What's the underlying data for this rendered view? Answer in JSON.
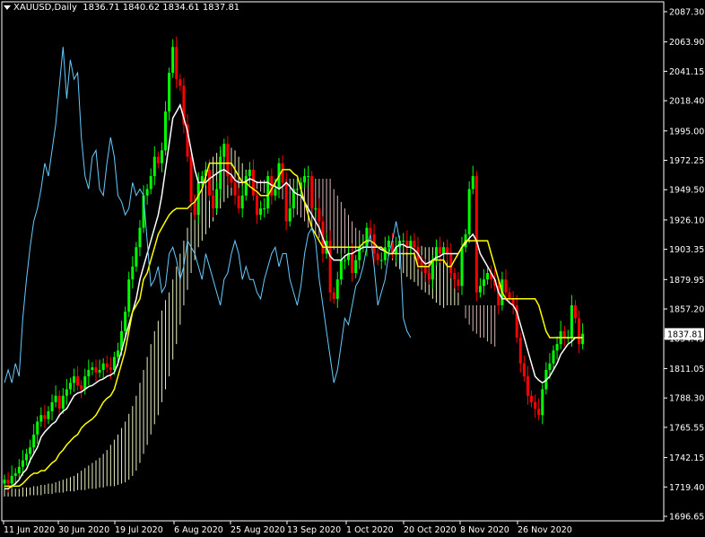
{
  "header": {
    "symbol": "XAUUSD,Daily",
    "ohlc": "1836.71 1840.62 1834.61 1837.81"
  },
  "colors": {
    "background": "#000000",
    "frame": "#ffffff",
    "text": "#ffffff",
    "bull": "#00ff00",
    "bear": "#ff0000",
    "tenkan": "#ffffff",
    "kijun": "#ffff00",
    "chikou": "#66ccff",
    "kumo_bear_hatch": "#d8b8b8",
    "kumo_bull_hatch": "#e8f0c0",
    "price_label_bg": "#ffffff",
    "price_label_text": "#000000"
  },
  "chart_data": {
    "type": "candlestick",
    "title": "XAUUSD,Daily",
    "indicator": "Ichimoku Kinko Hyo",
    "grid": false,
    "ylim": [
      1696.65,
      2087.3
    ],
    "y_ticks": [
      2087.3,
      2063.9,
      2041.15,
      2018.4,
      1995.0,
      1972.25,
      1949.5,
      1926.1,
      1903.35,
      1879.95,
      1857.2,
      1834.45,
      1811.05,
      1788.3,
      1765.55,
      1742.15,
      1719.4,
      1696.65
    ],
    "y_tick_labels": [
      "2087.30",
      "2063.90",
      "2041.15",
      "2018.40",
      "1995.00",
      "1972.25",
      "1949.50",
      "1926.10",
      "1903.35",
      "1879.95",
      "1857.20",
      "1834.45",
      "1811.05",
      "1788.30",
      "1765.55",
      "1742.15",
      "1719.40",
      "1696.65"
    ],
    "x_tick_labels": [
      "11 Jun 2020",
      "30 Jun 2020",
      "19 Jul 2020",
      "6 Aug 2020",
      "25 Aug 2020",
      "13 Sep 2020",
      "1 Oct 2020",
      "20 Oct 2020",
      "8 Nov 2020",
      "26 Nov 2020"
    ],
    "last_price": 1837.81,
    "last_price_label": "1837.81",
    "close": [
      1725,
      1722,
      1728,
      1730,
      1735,
      1740,
      1745,
      1750,
      1760,
      1770,
      1775,
      1772,
      1778,
      1785,
      1790,
      1780,
      1790,
      1795,
      1800,
      1805,
      1798,
      1795,
      1805,
      1810,
      1812,
      1808,
      1810,
      1815,
      1812,
      1810,
      1820,
      1825,
      1840,
      1855,
      1880,
      1890,
      1905,
      1920,
      1945,
      1950,
      1960,
      1975,
      1970,
      1980,
      2010,
      2040,
      2060,
      2035,
      2030,
      2000,
      1975,
      1940,
      1930,
      1955,
      1960,
      1965,
      1945,
      1935,
      1950,
      1975,
      1985,
      1960,
      1955,
      1945,
      1935,
      1945,
      1960,
      1965,
      1945,
      1930,
      1935,
      1935,
      1960,
      1945,
      1950,
      1970,
      1955,
      1925,
      1935,
      1950,
      1950,
      1955,
      1960,
      1960,
      1935,
      1935,
      1925,
      1900,
      1910,
      1870,
      1865,
      1880,
      1895,
      1895,
      1900,
      1885,
      1895,
      1905,
      1905,
      1920,
      1915,
      1900,
      1895,
      1895,
      1905,
      1910,
      1900,
      1905,
      1910,
      1910,
      1905,
      1910,
      1905,
      1895,
      1890,
      1885,
      1880,
      1895,
      1905,
      1900,
      1905,
      1900,
      1885,
      1880,
      1875,
      1905,
      1915,
      1950,
      1960,
      1870,
      1875,
      1880,
      1885,
      1880,
      1875,
      1860,
      1880,
      1870,
      1865,
      1860,
      1835,
      1815,
      1805,
      1790,
      1785,
      1780,
      1775,
      1795,
      1810,
      1815,
      1825,
      1830,
      1840,
      1835,
      1835,
      1860,
      1850,
      1830,
      1838
    ],
    "series": [
      {
        "name": "Tenkan-sen",
        "values": [
          1718,
          1718,
          1720,
          1722,
          1725,
          1730,
          1733,
          1740,
          1745,
          1750,
          1758,
          1762,
          1765,
          1768,
          1770,
          1775,
          1778,
          1780,
          1785,
          1790,
          1792,
          1793,
          1795,
          1797,
          1798,
          1800,
          1802,
          1803,
          1805,
          1806,
          1808,
          1815,
          1825,
          1835,
          1845,
          1855,
          1865,
          1880,
          1890,
          1900,
          1910,
          1920,
          1930,
          1945,
          1965,
          1985,
          2005,
          2010,
          2015,
          2005,
          1995,
          1980,
          1965,
          1955,
          1955,
          1955,
          1958,
          1960,
          1962,
          1964,
          1965,
          1963,
          1961,
          1957,
          1955,
          1955,
          1956,
          1958,
          1957,
          1955,
          1955,
          1955,
          1955,
          1953,
          1952,
          1950,
          1952,
          1955,
          1952,
          1948,
          1946,
          1945,
          1940,
          1935,
          1930,
          1925,
          1920,
          1912,
          1905,
          1898,
          1895,
          1895,
          1895,
          1898,
          1900,
          1900,
          1902,
          1903,
          1905,
          1905,
          1905,
          1905,
          1905,
          1903,
          1902,
          1900,
          1900,
          1905,
          1907,
          1907,
          1905,
          1905,
          1903,
          1900,
          1895,
          1892,
          1893,
          1895,
          1897,
          1898,
          1900,
          1900,
          1900,
          1900,
          1900,
          1905,
          1908,
          1912,
          1915,
          1910,
          1900,
          1895,
          1890,
          1885,
          1880,
          1870,
          1865,
          1865,
          1862,
          1860,
          1855,
          1845,
          1835,
          1825,
          1815,
          1805,
          1802,
          1800,
          1802,
          1805,
          1810,
          1815,
          1822,
          1826,
          1830,
          1832,
          1835,
          1835,
          1835
        ]
      },
      {
        "name": "Kijun-sen",
        "values": [
          1720,
          1720,
          1720,
          1720,
          1720,
          1722,
          1725,
          1728,
          1730,
          1730,
          1732,
          1732,
          1735,
          1738,
          1740,
          1745,
          1748,
          1752,
          1755,
          1758,
          1760,
          1765,
          1768,
          1770,
          1772,
          1775,
          1780,
          1785,
          1788,
          1790,
          1795,
          1805,
          1815,
          1825,
          1840,
          1855,
          1860,
          1865,
          1880,
          1885,
          1895,
          1905,
          1915,
          1920,
          1925,
          1930,
          1933,
          1935,
          1935,
          1935,
          1935,
          1938,
          1940,
          1945,
          1950,
          1960,
          1970,
          1970,
          1970,
          1970,
          1970,
          1970,
          1970,
          1965,
          1960,
          1955,
          1955,
          1952,
          1950,
          1948,
          1945,
          1945,
          1945,
          1950,
          1955,
          1960,
          1965,
          1965,
          1965,
          1962,
          1960,
          1950,
          1940,
          1930,
          1920,
          1915,
          1910,
          1905,
          1905,
          1905,
          1905,
          1905,
          1905,
          1905,
          1905,
          1905,
          1905,
          1905,
          1908,
          1910,
          1910,
          1908,
          1905,
          1905,
          1902,
          1900,
          1900,
          1900,
          1900,
          1900,
          1900,
          1900,
          1900,
          1890,
          1890,
          1890,
          1890,
          1895,
          1895,
          1895,
          1895,
          1890,
          1890,
          1895,
          1900,
          1905,
          1910,
          1910,
          1910,
          1910,
          1910,
          1910,
          1910,
          1900,
          1890,
          1880,
          1870,
          1865,
          1865,
          1865,
          1865,
          1865,
          1865,
          1865,
          1865,
          1865,
          1860,
          1850,
          1840,
          1835,
          1835,
          1835,
          1835,
          1835,
          1835,
          1835,
          1835,
          1835,
          1835
        ]
      },
      {
        "name": "Chikou Span",
        "values": [
          1800,
          1810,
          1800,
          1815,
          1805,
          1850,
          1880,
          1905,
          1925,
          1935,
          1950,
          1970,
          1960,
          1980,
          2000,
          2030,
          2060,
          2020,
          2050,
          2035,
          2040,
          1990,
          1960,
          1950,
          1975,
          1980,
          1950,
          1945,
          1970,
          1990,
          1975,
          1945,
          1940,
          1930,
          1935,
          1955,
          1945,
          1950,
          1945,
          1910,
          1875,
          1880,
          1890,
          1870,
          1875,
          1900,
          1905,
          1895,
          1880,
          1890,
          1910,
          1905,
          1900,
          1890,
          1880,
          1900,
          1890,
          1880,
          1870,
          1860,
          1880,
          1885,
          1900,
          1910,
          1900,
          1880,
          1890,
          1880,
          1880,
          1870,
          1865,
          1880,
          1890,
          1900,
          1905,
          1890,
          1900,
          1900,
          1880,
          1870,
          1860,
          1875,
          1900,
          1915,
          1920,
          1910,
          1880,
          1860,
          1840,
          1820,
          1800,
          1810,
          1830,
          1850,
          1845,
          1860,
          1875,
          1880,
          1890,
          1905,
          1915,
          1890,
          1860,
          1870,
          1880,
          1900,
          1910,
          1925,
          1910,
          1850,
          1840,
          1835
        ]
      },
      {
        "name": "Senkou Span A",
        "values": [
          1718,
          1718,
          1718,
          1718,
          1718,
          1719,
          1719,
          1719,
          1720,
          1720,
          1721,
          1721,
          1722,
          1722,
          1723,
          1724,
          1725,
          1726,
          1727,
          1728,
          1730,
          1732,
          1734,
          1736,
          1738,
          1740,
          1742,
          1745,
          1748,
          1752,
          1756,
          1760,
          1765,
          1770,
          1776,
          1782,
          1790,
          1800,
          1810,
          1820,
          1830,
          1840,
          1848,
          1856,
          1864,
          1870,
          1880,
          1890,
          1900,
          1910,
          1920,
          1932,
          1945,
          1955,
          1960,
          1965,
          1970,
          1975,
          1978,
          1980,
          1982,
          1983,
          1982,
          1980,
          1975,
          1970,
          1965,
          1960,
          1955,
          1950,
          1948,
          1947,
          1946,
          1945,
          1944,
          1943,
          1942,
          1940,
          1938,
          1935,
          1930,
          1928,
          1925,
          1920,
          1918,
          1915,
          1912,
          1910,
          1908,
          1905,
          1903,
          1900,
          1900,
          1900,
          1900,
          1900,
          1903,
          1905,
          1908,
          1910,
          1910,
          1908,
          1905,
          1905,
          1905,
          1905,
          1905,
          1906,
          1906,
          1906,
          1906,
          1906,
          1906,
          1906,
          1906,
          1905,
          1905,
          1905,
          1905,
          1902,
          1900,
          1895,
          1890,
          1880,
          1870,
          1860,
          1850,
          1845,
          1840,
          1838,
          1835,
          1835,
          1832,
          1830,
          1828
        ]
      },
      {
        "name": "Senkou Span B",
        "values": [
          1712,
          1712,
          1712,
          1712,
          1712,
          1712,
          1712,
          1713,
          1713,
          1713,
          1713,
          1714,
          1714,
          1714,
          1715,
          1715,
          1715,
          1716,
          1716,
          1716,
          1717,
          1717,
          1717,
          1718,
          1718,
          1718,
          1719,
          1719,
          1720,
          1720,
          1720,
          1721,
          1722,
          1723,
          1725,
          1728,
          1732,
          1738,
          1745,
          1752,
          1760,
          1768,
          1775,
          1785,
          1795,
          1805,
          1818,
          1830,
          1845,
          1860,
          1872,
          1885,
          1895,
          1905,
          1910,
          1915,
          1920,
          1925,
          1930,
          1935,
          1940,
          1943,
          1945,
          1948,
          1950,
          1952,
          1954,
          1955,
          1956,
          1956,
          1957,
          1957,
          1958,
          1958,
          1958,
          1958,
          1958,
          1958,
          1958,
          1958,
          1958,
          1958,
          1958,
          1958,
          1958,
          1958,
          1958,
          1958,
          1958,
          1958,
          1950,
          1945,
          1940,
          1935,
          1930,
          1925,
          1920,
          1918,
          1915,
          1912,
          1910,
          1908,
          1905,
          1905,
          1900,
          1898,
          1895,
          1890,
          1888,
          1885,
          1882,
          1880,
          1878,
          1875,
          1872,
          1870,
          1868,
          1865,
          1862,
          1860,
          1858,
          1860,
          1860,
          1860,
          1860,
          1860,
          1860,
          1860,
          1860,
          1860,
          1860,
          1860,
          1860,
          1860,
          1860
        ]
      }
    ]
  }
}
